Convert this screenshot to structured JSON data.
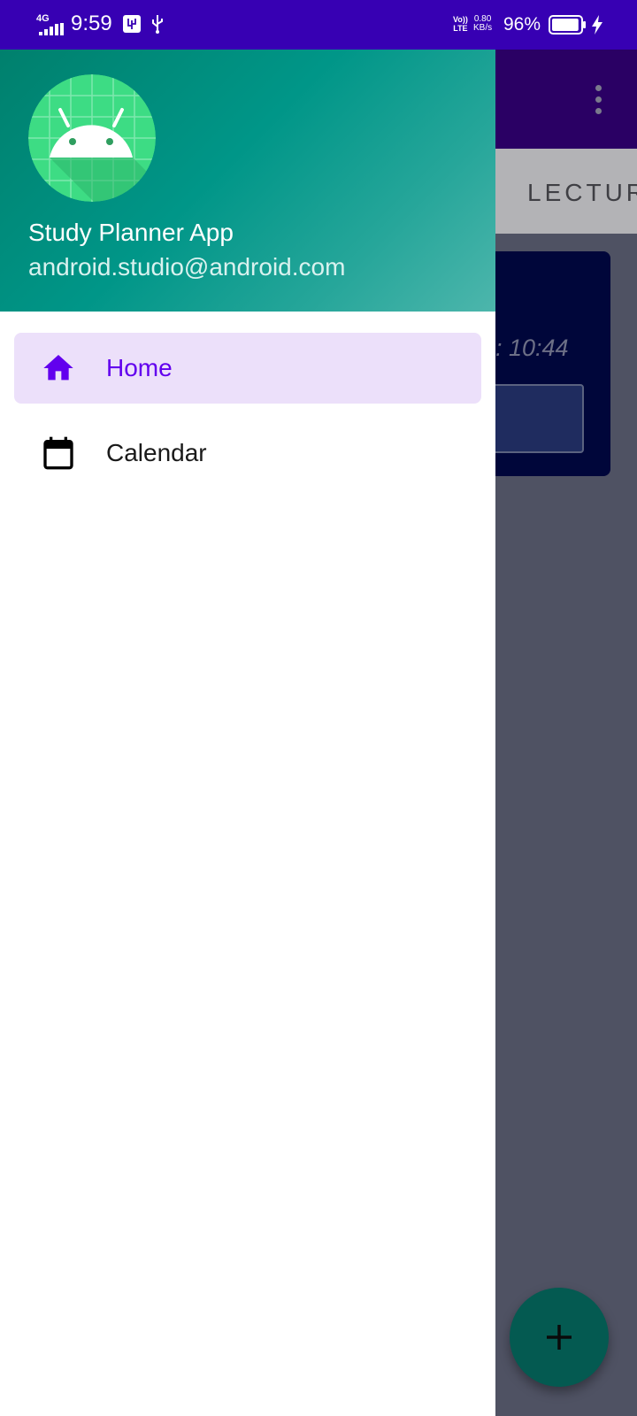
{
  "status_bar": {
    "network": "4G",
    "time": "9:59",
    "volte_line1": "Vo))",
    "volte_line2": "LTE",
    "speed_value": "0.80",
    "speed_unit": "KB/s",
    "battery_percent": "96%",
    "battery_level": 0.96,
    "icons": [
      "signal-bars-icon",
      "usb-debugging-icon",
      "usb-icon",
      "battery-icon",
      "charging-bolt-icon"
    ]
  },
  "drawer": {
    "header": {
      "avatar_icon": "android-robot-icon",
      "title": "Study Planner App",
      "email": "android.studio@android.com",
      "gradient_colors": [
        "#00806d",
        "#009688",
        "#4db6ac"
      ]
    },
    "items": [
      {
        "label": "Home",
        "icon": "home-icon",
        "selected": true
      },
      {
        "label": "Calendar",
        "icon": "calendar-icon",
        "selected": false
      }
    ]
  },
  "background_screen": {
    "tab_label_partial": "LECTUR",
    "card_time_partial": ": 10:44",
    "fab_icon": "plus-icon",
    "overflow_icon": "more-vert-icon"
  },
  "colors": {
    "status_bar": "#3700b3",
    "accent": "#6200ee",
    "selected_item_bg": "#ece0fa",
    "fab": "#045a51"
  }
}
